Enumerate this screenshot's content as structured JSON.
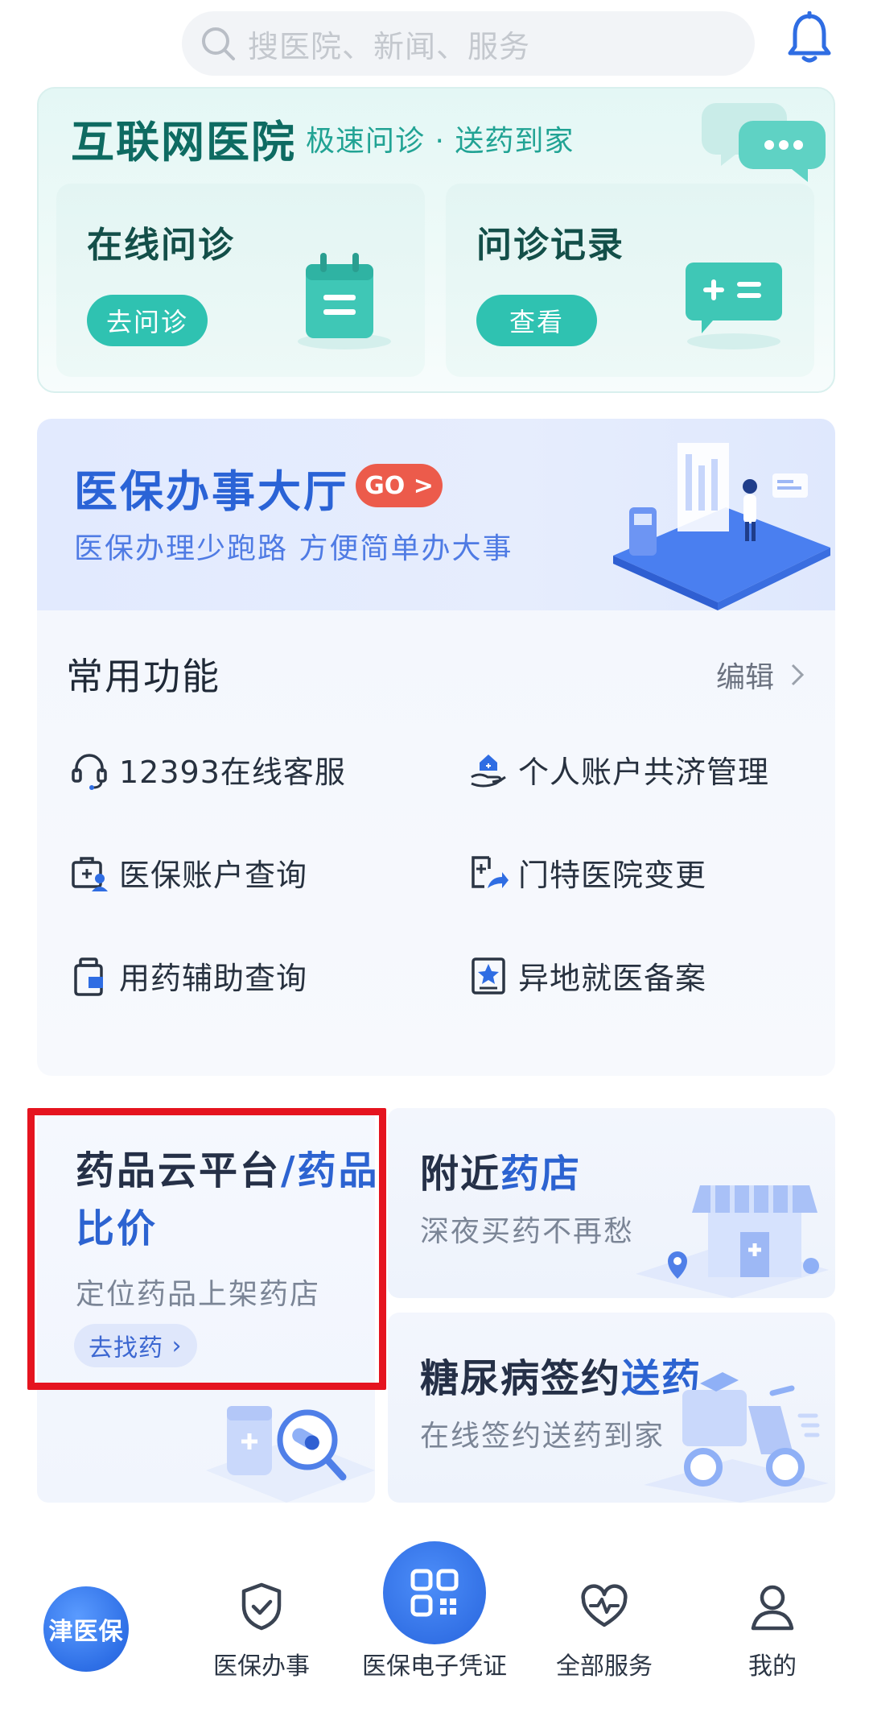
{
  "header": {
    "search_placeholder": "搜医院、新闻、服务"
  },
  "hospital": {
    "title": "互联网医院",
    "subtitle": "极速问诊 · 送药到家",
    "cards": [
      {
        "title": "在线问诊",
        "button": "去问诊"
      },
      {
        "title": "问诊记录",
        "button": "查看"
      }
    ]
  },
  "banner": {
    "title": "医保办事大厅",
    "badge": "GO",
    "subtitle": "医保办理少跑路 方便简单办大事"
  },
  "common": {
    "title": "常用功能",
    "edit_label": "编辑",
    "items": [
      {
        "label": "12393在线客服",
        "icon": "headset-icon"
      },
      {
        "label": "个人账户共济管理",
        "icon": "hand-house-icon"
      },
      {
        "label": "医保账户查询",
        "icon": "medical-account-icon"
      },
      {
        "label": "门特医院变更",
        "icon": "hospital-change-icon"
      },
      {
        "label": "用药辅助查询",
        "icon": "medicine-bottle-icon"
      },
      {
        "label": "异地就医备案",
        "icon": "star-document-icon"
      }
    ]
  },
  "features": {
    "drug_platform": {
      "title_part1": "药品云平台",
      "title_part2": "/药品",
      "title_part3": "比价",
      "subtitle": "定位药品上架药店",
      "button": "去找药"
    },
    "nearby_pharmacy": {
      "title_part1": "附近",
      "title_part2": "药店",
      "subtitle": "深夜买药不再愁"
    },
    "diabetes": {
      "title_part1": "糖尿病签约",
      "title_part2": "送药",
      "subtitle": "在线签约送药到家"
    }
  },
  "tabbar": {
    "logo": "津医保",
    "tabs": [
      {
        "label": "医保办事",
        "icon": "shield-check-icon"
      },
      {
        "label": "医保电子凭证",
        "icon": "qr-code-icon"
      },
      {
        "label": "全部服务",
        "icon": "heart-pulse-icon"
      },
      {
        "label": "我的",
        "icon": "user-icon"
      }
    ]
  },
  "colors": {
    "brand_blue": "#2c63d1",
    "teal": "#2fc2b1",
    "highlight_red": "#e5141f",
    "go_red": "#ec5b4b"
  }
}
